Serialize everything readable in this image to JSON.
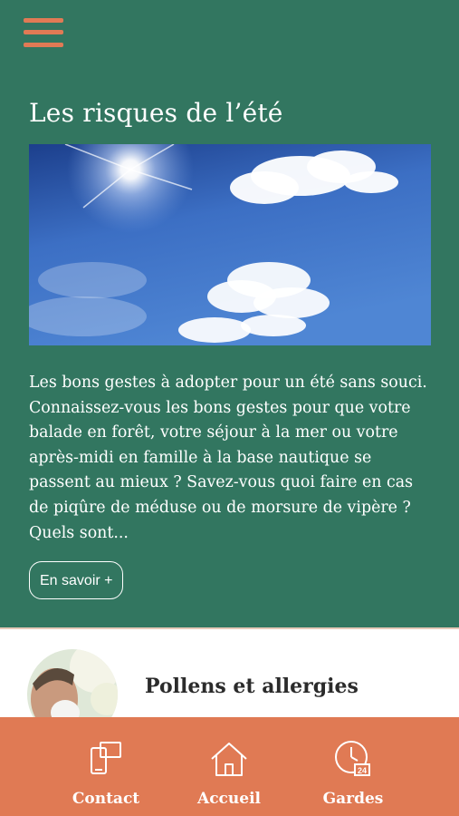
{
  "menu": {
    "icon": "hamburger-menu-icon"
  },
  "article": {
    "title": "Les risques de l’été",
    "image": "sunny-sky-clouds-photo",
    "excerpt": "Les bons gestes à adopter pour un été sans souci. Connaissez-vous les bons gestes pour que votre balade en forêt, votre séjour à la mer ou votre après-midi en famille à la base nautique se passent au mieux ? Savez-vous quoi faire en cas de piqûre de méduse ou de morsure de vipère ? Quels sont...",
    "more_label": "En savoir +"
  },
  "next_card": {
    "title": "Pollens et allergies",
    "image": "person-sneezing-photo"
  },
  "tabbar": {
    "tabs": [
      {
        "label": "Contact",
        "icon": "contact-devices-icon"
      },
      {
        "label": "Accueil",
        "icon": "home-icon"
      },
      {
        "label": "Gardes",
        "icon": "clock-24h-icon"
      }
    ]
  },
  "colors": {
    "hero_bg": "#327660",
    "accent": "#e07a54",
    "text_light": "#ffffff",
    "text_dark": "#2b2b2b"
  }
}
